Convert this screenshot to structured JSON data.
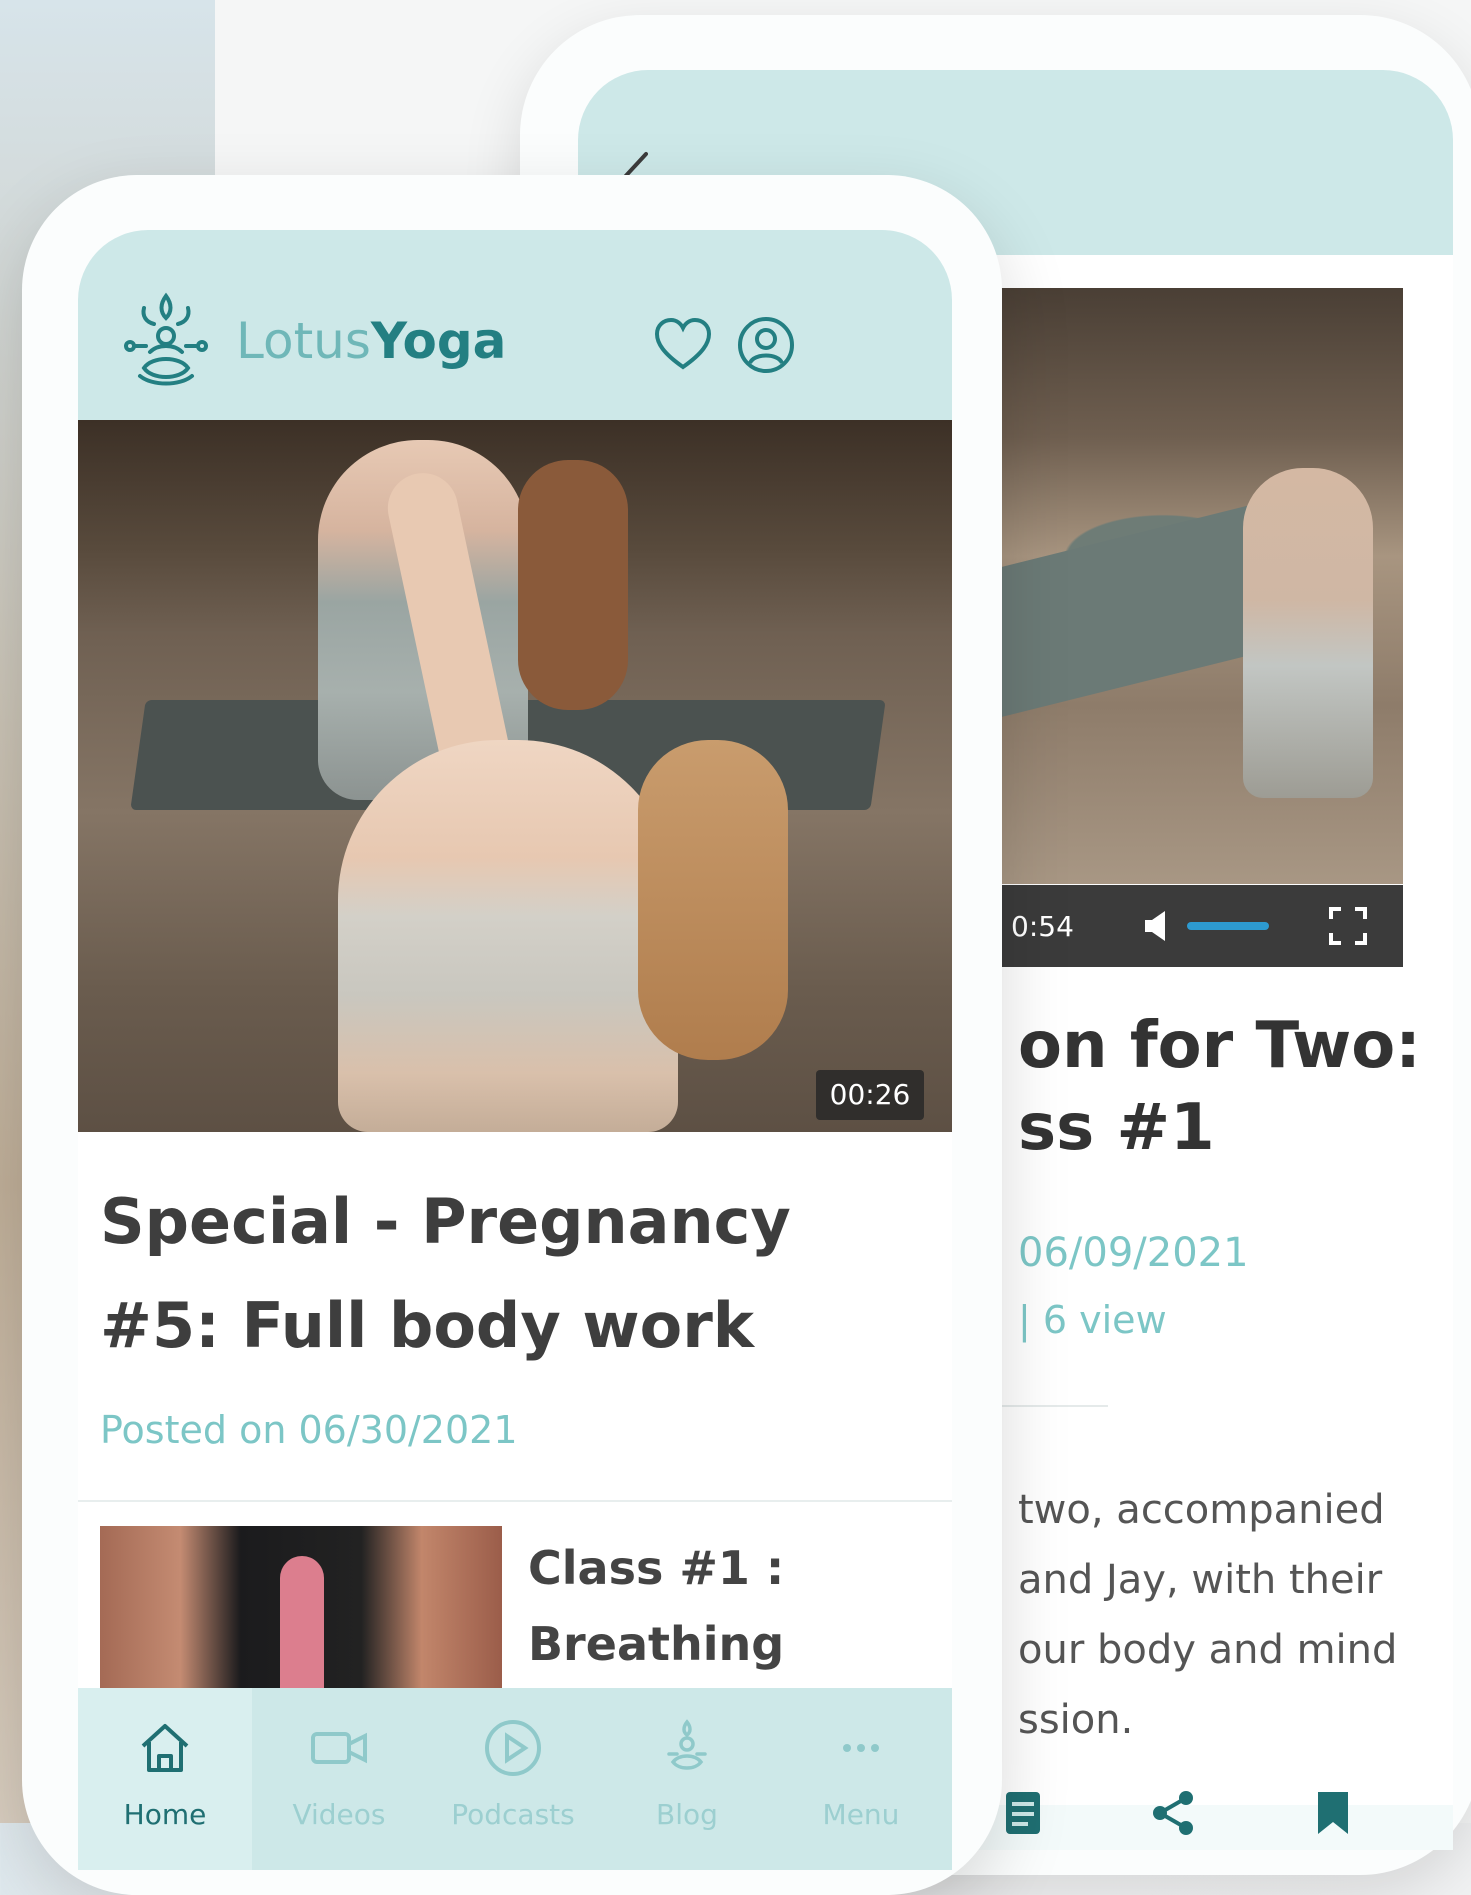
{
  "colors": {
    "brand_light": "#6fb7b8",
    "brand_dark": "#237f82",
    "header_bg": "#cde8e8",
    "accent_text": "#7cc6c6",
    "video_slider": "#2d9ad0"
  },
  "front": {
    "logo": {
      "part1": "Lotus",
      "part2": "Yoga",
      "icon": "lotus-icon"
    },
    "header_icons": [
      "heart-icon",
      "profile-icon"
    ],
    "hero": {
      "duration": "00:26"
    },
    "article": {
      "title": "Special - Pregnancy #5: Full body work",
      "posted": "Posted on 06/30/2021"
    },
    "next_item": {
      "title": "Class #1 : Breathing"
    },
    "tabs": [
      {
        "label": "Home",
        "icon": "home-icon",
        "active": true
      },
      {
        "label": "Videos",
        "icon": "video-camera-icon",
        "active": false
      },
      {
        "label": "Podcasts",
        "icon": "play-circle-icon",
        "active": false
      },
      {
        "label": "Blog",
        "icon": "lotus-icon",
        "active": false
      },
      {
        "label": "Menu",
        "icon": "more-icon",
        "active": false
      }
    ]
  },
  "back": {
    "video": {
      "time": "0:54",
      "volume_level": 0.8
    },
    "title_lines": [
      "on for Two:",
      "ss #1"
    ],
    "date": "06/09/2021",
    "views": "| 6 view",
    "description_lines": [
      "two, accompanied",
      "and Jay, with their",
      "our body and mind",
      "ssion."
    ],
    "bottom_icons": [
      "article-icon",
      "share-icon",
      "bookmark-icon"
    ]
  }
}
